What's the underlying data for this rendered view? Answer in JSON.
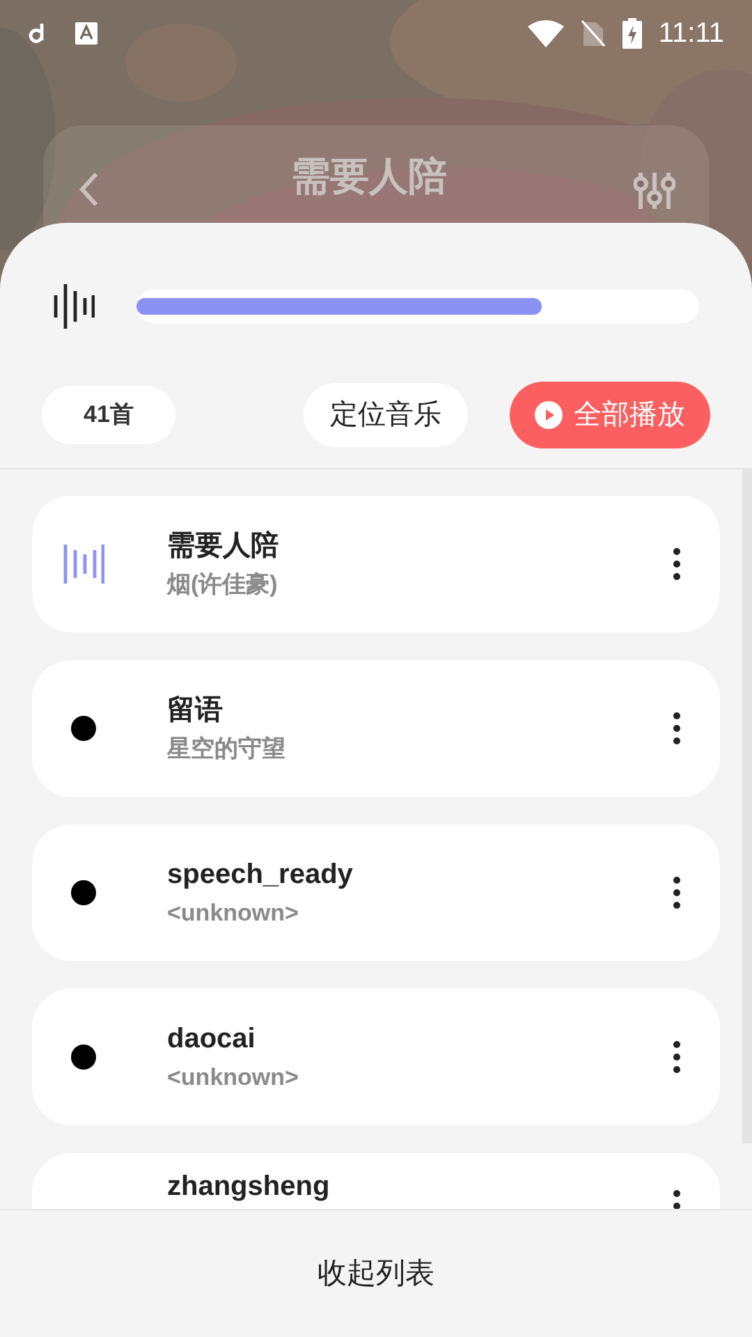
{
  "status_bar": {
    "time": "11:11"
  },
  "header": {
    "title": "需要人陪"
  },
  "player": {
    "level": 0.72
  },
  "toolbar": {
    "count": "41首",
    "locate_button": "定位音乐",
    "play_all_button": "全部播放"
  },
  "songs": [
    {
      "title": "需要人陪",
      "artist": "烟(许佳豪)",
      "selected": true
    },
    {
      "title": "留语",
      "artist": "星空的守望",
      "selected": false
    },
    {
      "title": "speech_ready",
      "artist": "<unknown>",
      "selected": false
    },
    {
      "title": "daocai",
      "artist": "<unknown>",
      "selected": false
    },
    {
      "title": "zhangsheng",
      "selected": false
    }
  ],
  "footer": {
    "collapse_button": "收起列表"
  }
}
